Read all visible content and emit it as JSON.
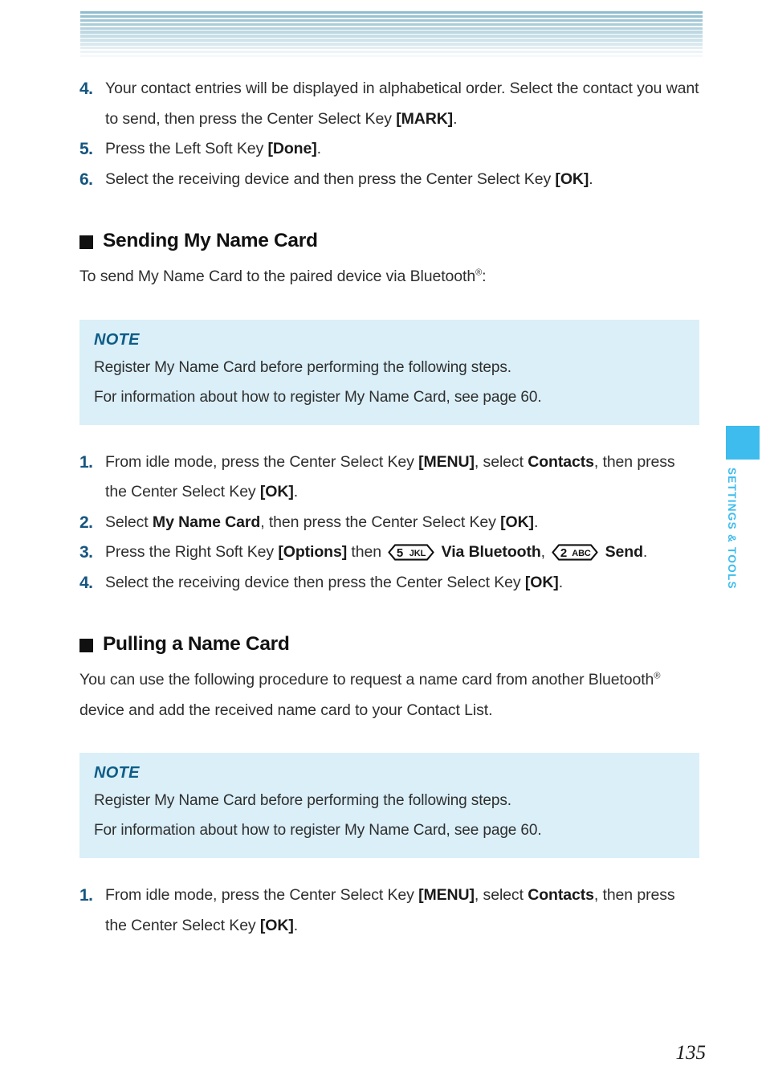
{
  "document": {
    "page_number": "135",
    "side_tab_label": "SETTINGS & TOOLS",
    "colors": {
      "step_number": "#15557f",
      "note_background": "#daeff8",
      "note_title": "#0e5c86",
      "side_tab": "#3dbced",
      "header_stripe_top": "#8ebcce"
    }
  },
  "header": {
    "stripe_count": 13
  },
  "top_steps": [
    {
      "number": "4.",
      "lines": [
        {
          "runs": [
            {
              "t": "Your contact entries will be displayed in alphabetical order. Select the contact you want to send, then press the Center Select Key ",
              "b": false
            },
            {
              "t": "[MARK]",
              "b": true
            },
            {
              "t": ".",
              "b": false
            }
          ]
        }
      ]
    },
    {
      "number": "5.",
      "lines": [
        {
          "runs": [
            {
              "t": "Press the Left Soft Key ",
              "b": false
            },
            {
              "t": "[Done]",
              "b": true
            },
            {
              "t": ".",
              "b": false
            }
          ]
        }
      ]
    },
    {
      "number": "6.",
      "lines": [
        {
          "runs": [
            {
              "t": "Select the receiving device and then press the Center Select Key ",
              "b": false
            },
            {
              "t": "[OK]",
              "b": true
            },
            {
              "t": ".",
              "b": false
            }
          ]
        }
      ]
    }
  ],
  "section_one": {
    "heading": "Sending My Name Card",
    "intro_before": "To send My Name Card to the paired device via Bluetooth",
    "intro_sup": "®",
    "intro_after": ":",
    "note": {
      "title": "NOTE",
      "line1": "Register My Name Card before performing the following steps.",
      "line2": "For information about how to register My Name Card, see page 60."
    },
    "steps": [
      {
        "number": "1.",
        "parts": [
          {
            "t": "From idle mode, press the Center Select Key ",
            "b": false
          },
          {
            "t": "[MENU]",
            "b": true
          },
          {
            "t": ", select ",
            "b": false
          },
          {
            "t": "Contacts",
            "b": true
          },
          {
            "t": ", then press the Center Select Key ",
            "b": false
          },
          {
            "t": "[OK]",
            "b": true
          },
          {
            "t": ".",
            "b": false
          }
        ]
      },
      {
        "number": "2.",
        "parts": [
          {
            "t": "Select ",
            "b": false
          },
          {
            "t": "My Name Card",
            "b": true
          },
          {
            "t": ", then press the Center Select Key ",
            "b": false
          },
          {
            "t": "[OK]",
            "b": true
          },
          {
            "t": ".",
            "b": false
          }
        ]
      },
      {
        "number": "3.",
        "parts": [
          {
            "t": "Press the Right Soft Key ",
            "b": false
          },
          {
            "t": "[Options]",
            "b": true
          },
          {
            "t": " then ",
            "b": false
          },
          {
            "key": {
              "digit": "5",
              "letters": "JKL"
            }
          },
          {
            "t": " ",
            "b": false
          },
          {
            "t": "Via Bluetooth",
            "b": true
          },
          {
            "t": ", ",
            "b": false
          },
          {
            "key": {
              "digit": "2",
              "letters": "ABC"
            }
          },
          {
            "t": " ",
            "b": false
          },
          {
            "t": "Send",
            "b": true
          },
          {
            "t": ".",
            "b": false
          }
        ]
      },
      {
        "number": "4.",
        "parts": [
          {
            "t": "Select the receiving device then press the Center Select Key ",
            "b": false
          },
          {
            "t": "[OK]",
            "b": true
          },
          {
            "t": ".",
            "b": false
          }
        ]
      }
    ]
  },
  "section_two": {
    "heading": "Pulling a Name Card",
    "intro_part1": "You can use the following procedure to request a name card from another Bluetooth",
    "intro_sup": "®",
    "intro_part2": " device and add the received name card to your Contact List.",
    "note": {
      "title": "NOTE",
      "line1": "Register My Name Card before performing the following steps.",
      "line2": "For information about how to register My Name Card, see page 60."
    },
    "steps": [
      {
        "number": "1.",
        "parts": [
          {
            "t": "From idle mode, press the Center Select Key ",
            "b": false
          },
          {
            "t": "[MENU]",
            "b": true
          },
          {
            "t": ", select ",
            "b": false
          },
          {
            "t": "Contacts",
            "b": true
          },
          {
            "t": ", then press the Center Select Key ",
            "b": false
          },
          {
            "t": "[OK]",
            "b": true
          },
          {
            "t": ".",
            "b": false
          }
        ]
      }
    ]
  }
}
